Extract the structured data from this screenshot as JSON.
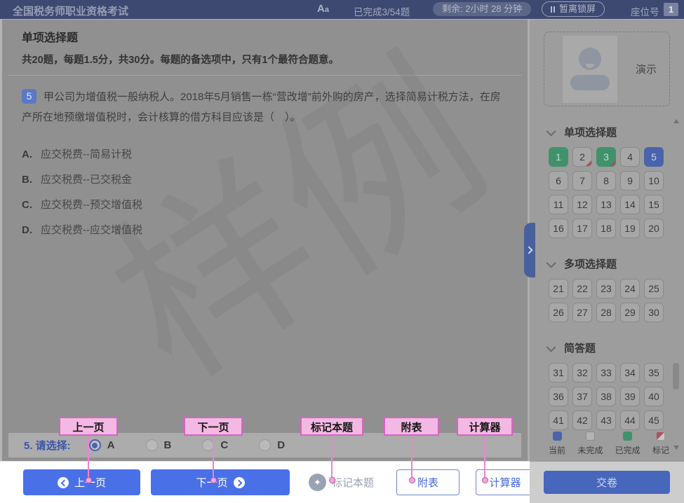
{
  "topbar": {
    "title": "全国税务师职业资格考试",
    "font_icon_big": "A",
    "font_icon_small": "a",
    "progress": "已完成3/54题",
    "timer": "剩余: 2小时 28 分钟",
    "lock_label": "暂离锁屏",
    "seat_label": "座位号",
    "seat_value": "1"
  },
  "question_panel": {
    "section_title": "单项选择题",
    "section_desc": "共20题，每题1.5分，共30分。每题的备选项中，只有1个最符合题意。",
    "question_no": "5",
    "question_text": "甲公司为增值税一般纳税人。2018年5月销售一栋“营改增”前外购的房产，选择简易计税方法，在房产所在地预缴增值税时，会计核算的借方科目应该是（　）。",
    "options": [
      {
        "letter": "A.",
        "text": "应交税费--简易计税"
      },
      {
        "letter": "B.",
        "text": "应交税费--已交税金"
      },
      {
        "letter": "C.",
        "text": "应交税费--预交增值税"
      },
      {
        "letter": "D.",
        "text": "应交税费--应交增值税"
      }
    ],
    "watermark": "样例"
  },
  "answer_bar": {
    "label": "5. 请选择:",
    "choices": [
      "A",
      "B",
      "C",
      "D"
    ],
    "selected": "A"
  },
  "callouts": [
    {
      "label": "上一页"
    },
    {
      "label": "下一页"
    },
    {
      "label": "标记本题"
    },
    {
      "label": "附表"
    },
    {
      "label": "计算器"
    }
  ],
  "toolbar": {
    "prev_label": "上一页",
    "next_label": "下一页",
    "mark_label": "标记本题",
    "mark_glyph": "✦",
    "appendix_label": "附表",
    "calculator_label": "计算器",
    "submit_label": "交卷"
  },
  "sidebar": {
    "demo_label": "演示",
    "sections": [
      {
        "title": "单项选择题",
        "start": 1,
        "end": 20,
        "states": {
          "1": "done",
          "2": "todo marked",
          "3": "done marked",
          "5": "current"
        }
      },
      {
        "title": "多项选择题",
        "start": 21,
        "end": 30,
        "states": {}
      },
      {
        "title": "简答题",
        "start": 31,
        "end": 45,
        "states": {}
      }
    ],
    "legend": [
      {
        "label": "当前",
        "state": "current"
      },
      {
        "label": "未完成",
        "state": "todo"
      },
      {
        "label": "已完成",
        "state": "done"
      },
      {
        "label": "标记",
        "state": "marked"
      }
    ]
  },
  "colors": {
    "topbar_navy": "#3e4972",
    "accent_blue": "#4a70e8",
    "tile_done_green": "#41926c",
    "tile_current_blue": "#4a63ad",
    "marked_red": "#a84f58",
    "callout_pink": "#f3b8e3",
    "callout_border_magenta": "#d863c5",
    "submit_blue": "#4767bd"
  }
}
